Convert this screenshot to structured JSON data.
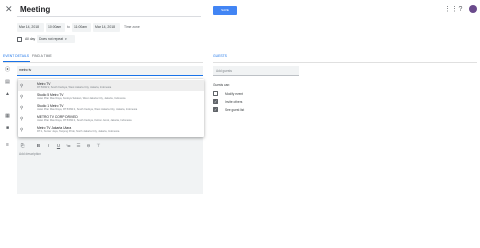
{
  "header": {
    "close_glyph": "✕",
    "title": "Meeting",
    "save_label": "SAVE",
    "apps_glyph": "⋮⋮",
    "help_glyph": "?"
  },
  "datetime": {
    "start_date": "Mar 14, 2018",
    "start_time": "10:00am",
    "to": "to",
    "end_time": "11:00am",
    "end_date": "Mar 14, 2018",
    "time_zone": "Time zone",
    "all_day": "All day",
    "repeat": "Does not repeat"
  },
  "tabs": {
    "event_details": "EVENT DETAILS",
    "find_a_time": "FIND A TIME",
    "guests": "GUESTS"
  },
  "location": {
    "value": "metro tv"
  },
  "suggestions": [
    {
      "name": "Metro TV",
      "address": "RT.5/RW.2, South Kedoya, West Jakarta City, Jakarta, Indonesia"
    },
    {
      "name": "Studio 5 Metro TV",
      "address": "Jalan Pilar Mas Raya, Kedoya Selatan, West Jakarta City, Jakarta, Indonesia"
    },
    {
      "name": "Studio 1 Metro TV",
      "address": "Jalan Pilar Mas Raya, RT.5/RW.2, South Kedoya, West Jakarta City, Jakarta, Indonesia"
    },
    {
      "name": "METRO TV CORP DRIVED",
      "address": "Jalan Pilar Mas Raya, RT.5/RW.2, South Kedoya, Kebon Jeruk, Jakarta, Indonesia"
    },
    {
      "name": "Metro TV Jakarta Utara",
      "address": "RT.1, Sunter Jaya, Tanjung Priok, North Jakarta City, Jakarta, Indonesia"
    }
  ],
  "description": {
    "placeholder": "Add description"
  },
  "guests": {
    "placeholder": "Add guests",
    "permissions_label": "Guests can:",
    "permissions": [
      {
        "label": "Modify event",
        "checked": false
      },
      {
        "label": "Invite others",
        "checked": true
      },
      {
        "label": "See guest list",
        "checked": true
      }
    ]
  },
  "colors": {
    "accent": "#1a73e8",
    "save_button": "#4285f4",
    "avatar": "#6a4a8c"
  }
}
